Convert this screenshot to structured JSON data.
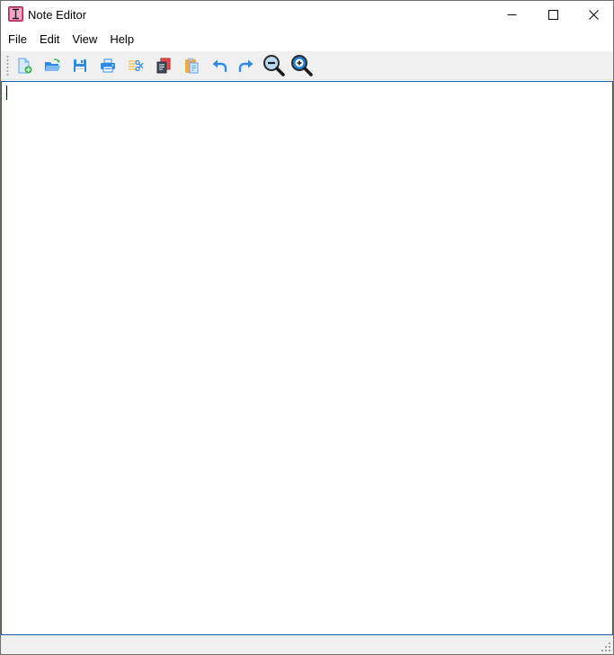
{
  "window": {
    "title": "Note Editor",
    "icons": {
      "app": "text-cursor-app-icon",
      "minimize": "minimize-icon",
      "maximize": "maximize-icon",
      "close": "close-icon"
    }
  },
  "menu": {
    "items": [
      {
        "label": "File"
      },
      {
        "label": "Edit"
      },
      {
        "label": "View"
      },
      {
        "label": "Help"
      }
    ]
  },
  "toolbar": {
    "buttons": [
      {
        "name": "new-file",
        "icon": "new-file-icon"
      },
      {
        "name": "open-folder",
        "icon": "open-folder-icon"
      },
      {
        "name": "save",
        "icon": "save-icon"
      },
      {
        "name": "print",
        "icon": "print-icon"
      },
      {
        "name": "cut",
        "icon": "cut-icon"
      },
      {
        "name": "copy",
        "icon": "copy-icon"
      },
      {
        "name": "paste",
        "icon": "paste-icon"
      },
      {
        "name": "undo",
        "icon": "undo-icon"
      },
      {
        "name": "redo",
        "icon": "redo-icon"
      },
      {
        "name": "zoom-out",
        "icon": "zoom-out-icon"
      },
      {
        "name": "zoom-in",
        "icon": "zoom-in-icon"
      }
    ]
  },
  "editor": {
    "content": ""
  },
  "colors": {
    "accent": "#1e5a9c",
    "toolbar_bg": "#f0f0f0",
    "icon_blue": "#2f8ae5"
  }
}
